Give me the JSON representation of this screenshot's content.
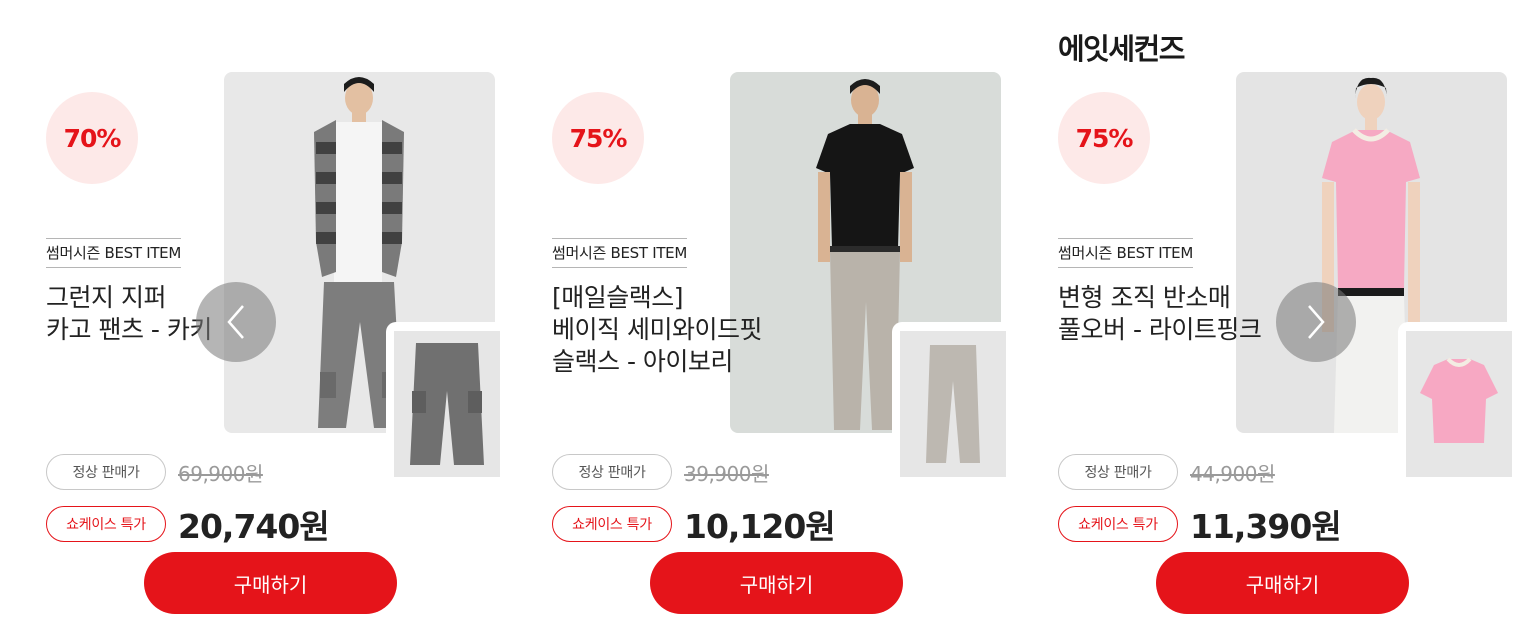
{
  "brand": {
    "title": "에잇세컨즈"
  },
  "products": [
    {
      "discount": "70%",
      "badge": "썸머시즌 BEST ITEM",
      "name_lines": [
        "그런지 지퍼",
        "카고 팬츠 - 카키"
      ],
      "regular_label": "정상 판매가",
      "regular_price": "69,900원",
      "special_label": "쇼케이스 특가",
      "special_price": "20,740원",
      "buy_label": "구매하기"
    },
    {
      "discount": "75%",
      "badge": "썸머시즌 BEST ITEM",
      "name_lines": [
        "[매일슬랙스]",
        "베이직 세미와이드핏",
        "슬랙스 - 아이보리"
      ],
      "regular_label": "정상 판매가",
      "regular_price": "39,900원",
      "special_label": "쇼케이스 특가",
      "special_price": "10,120원",
      "buy_label": "구매하기"
    },
    {
      "discount": "75%",
      "badge": "썸머시즌 BEST ITEM",
      "name_lines": [
        "변형 조직 반소매",
        "풀오버 - 라이트핑크"
      ],
      "regular_label": "정상 판매가",
      "regular_price": "44,900원",
      "special_label": "쇼케이스 특가",
      "special_price": "11,390원",
      "buy_label": "구매하기"
    }
  ],
  "carousel": {
    "prev_icon": "chevron-left-icon",
    "next_icon": "chevron-right-icon"
  },
  "colors": {
    "accent": "#e5141a",
    "discount_bg": "#fde9e8"
  }
}
